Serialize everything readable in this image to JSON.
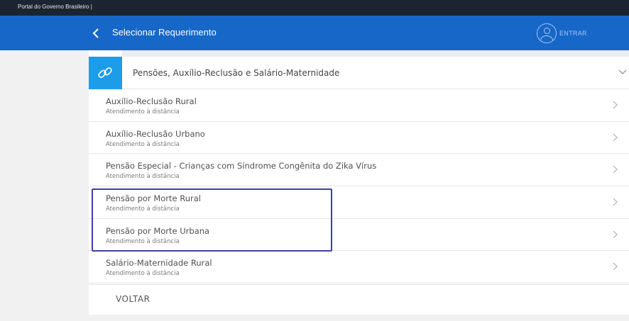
{
  "gov_bar": {
    "text": "Portal do Governo Brasileiro   |"
  },
  "header": {
    "title": "Selecionar Requerimento",
    "login_label": "ENTRAR"
  },
  "category": {
    "title": "Pensões, Auxílio-Reclusão e Salário-Maternidade",
    "icon": "link-icon"
  },
  "items": [
    {
      "title": "Auxílio-Reclusão Rural",
      "subtitle": "Atendimento à distância"
    },
    {
      "title": "Auxílio-Reclusão Urbano",
      "subtitle": "Atendimento à distância"
    },
    {
      "title": "Pensão Especial - Crianças com Síndrome Congênita do Zika Vírus",
      "subtitle": "Atendimento à distância"
    },
    {
      "title": "Pensão por Morte Rural",
      "subtitle": "Atendimento à distância"
    },
    {
      "title": "Pensão por Morte Urbana",
      "subtitle": "Atendimento à distância"
    },
    {
      "title": "Salário-Maternidade Rural",
      "subtitle": "Atendimento à distância"
    }
  ],
  "footer": {
    "back_label": "VOLTAR"
  },
  "colors": {
    "header_blue": "#1667c8",
    "category_icon_bg": "#1e9ce8",
    "highlight_border": "#3a3fb0"
  }
}
